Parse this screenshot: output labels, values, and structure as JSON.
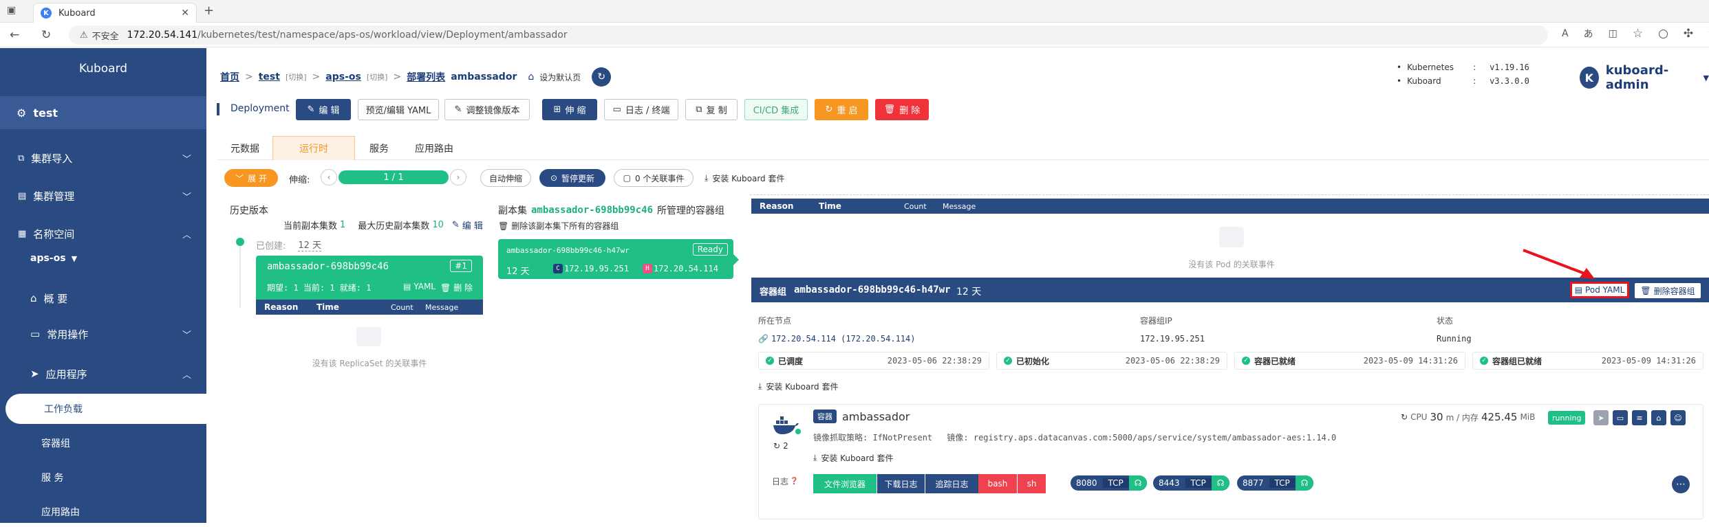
{
  "browser": {
    "tab_title": "Kuboard",
    "favicon": "K",
    "security": "不安全",
    "url_host": "172.20.54.141",
    "url_path": "/kubernetes/test/namespace/aps-os/workload/view/Deployment/ambassador"
  },
  "sidebar": {
    "brand": "Kuboard",
    "cluster": "test",
    "items": [
      {
        "label": "集群导入"
      },
      {
        "label": "集群管理"
      },
      {
        "label": "名称空间"
      }
    ],
    "namespace": "aps-os",
    "ns_items": [
      {
        "label": "概 要"
      },
      {
        "label": "常用操作"
      },
      {
        "label": "应用程序"
      }
    ],
    "app_items": [
      {
        "label": "工作负载"
      },
      {
        "label": "容器组"
      },
      {
        "label": "服 务"
      },
      {
        "label": "应用路由"
      }
    ]
  },
  "breadcrumb": {
    "home": "首页",
    "cluster": "test",
    "cluster_switch": "[切换]",
    "ns": "aps-os",
    "ns_switch": "[切换]",
    "list": "部署列表",
    "current": "ambassador",
    "set_default": "设为默认页"
  },
  "version": {
    "k8s_label": "Kubernetes",
    "k8s_value": "v1.19.16",
    "kb_label": "Kuboard",
    "kb_value": "v3.3.0.0",
    "sep": ":"
  },
  "user": {
    "avatar": "K",
    "name": "kuboard-admin"
  },
  "toolbar": {
    "kind": "Deployment",
    "edit": "编 辑",
    "yaml": "预览/编辑 YAML",
    "image": "调整镜像版本",
    "scale": "伸 缩",
    "logs": "日志 / 终端",
    "copy": "复 制",
    "cicd": "CI/CD 集成",
    "restart": "重 启",
    "delete": "删 除"
  },
  "tabs": [
    "元数据",
    "运行时",
    "服务",
    "应用路由"
  ],
  "runtime_bar": {
    "expand": "展 开",
    "scale_label": "伸缩:",
    "scale_value": "1 / 1",
    "autoscale": "自动伸缩",
    "pause": "暂停更新",
    "events": "0 个关联事件",
    "install": "安装 Kuboard 套件"
  },
  "history": {
    "title": "历史版本",
    "current_label": "当前副本集数",
    "current_value": "1",
    "max_label": "最大历史副本集数",
    "max_value": "10",
    "edit": "编 辑",
    "created_label": "已创建:",
    "created_value": "12 天",
    "rs_name": "ambassador-698bb99c46",
    "rs_badge": "#1",
    "rs_stats": "期望: 1 当前: 1 就绪: 1",
    "rs_yaml": "YAML",
    "rs_delete": "删 除",
    "no_events": "没有该 ReplicaSet 的关联事件"
  },
  "event_cols": {
    "reason": "Reason",
    "time": "Time",
    "count": "Count",
    "message": "Message"
  },
  "replicaset": {
    "title_prefix": "副本集",
    "title_name": "ambassador-698bb99c46",
    "title_suffix": "所管理的容器组",
    "delete_all": "删除该副本集下所有的容器组",
    "pod_name": "ambassador-698bb99c46-h47wr",
    "pod_status": "Ready",
    "pod_age": "12 天",
    "pod_ip": "172.19.95.251",
    "host_ip": "172.20.54.114"
  },
  "pod_events": {
    "no_events": "没有该 Pod 的关联事件"
  },
  "pod_panel": {
    "label": "容器组",
    "name": "ambassador-698bb99c46-h47wr",
    "age": "12 天",
    "yaml_btn": "Pod YAML",
    "delete_btn": "删除容器组",
    "node_label": "所在节点",
    "node_value": "172.20.54.114 (172.20.54.114)",
    "ip_label": "容器组IP",
    "ip_value": "172.19.95.251",
    "status_label": "状态",
    "status_value": "Running",
    "conditions": [
      {
        "label": "已调度",
        "time": "2023-05-06 22:38:29"
      },
      {
        "label": "已初始化",
        "time": "2023-05-06 22:38:29"
      },
      {
        "label": "容器已就绪",
        "time": "2023-05-09 14:31:26"
      },
      {
        "label": "容器组已就绪",
        "time": "2023-05-09 14:31:26"
      }
    ],
    "install": "安装 Kuboard 套件"
  },
  "container": {
    "tag": "容器",
    "name": "ambassador",
    "restarts": "2",
    "cpu_label": "CPU",
    "cpu_value": "30",
    "cpu_unit": "m / 内存",
    "mem_value": "425.45",
    "mem_unit": "MiB",
    "state": "running",
    "pull_policy": "镜像抓取策略: IfNotPresent",
    "image": "镜像: registry.aps.datacanvas.com:5000/aps/service/system/ambassador-aes:1.14.0",
    "install": "安装 Kuboard 套件",
    "log_label": "日志",
    "actions": [
      "文件浏览器",
      "下载日志",
      "追踪日志",
      "bash",
      "sh"
    ],
    "ports": [
      {
        "port": "8080",
        "proto": "TCP"
      },
      {
        "port": "8443",
        "proto": "TCP"
      },
      {
        "port": "8877",
        "proto": "TCP"
      }
    ]
  },
  "colors": {
    "primary": "#2a4a82",
    "green": "#1fbf86",
    "orange": "#f79620",
    "red": "#f0323a"
  }
}
